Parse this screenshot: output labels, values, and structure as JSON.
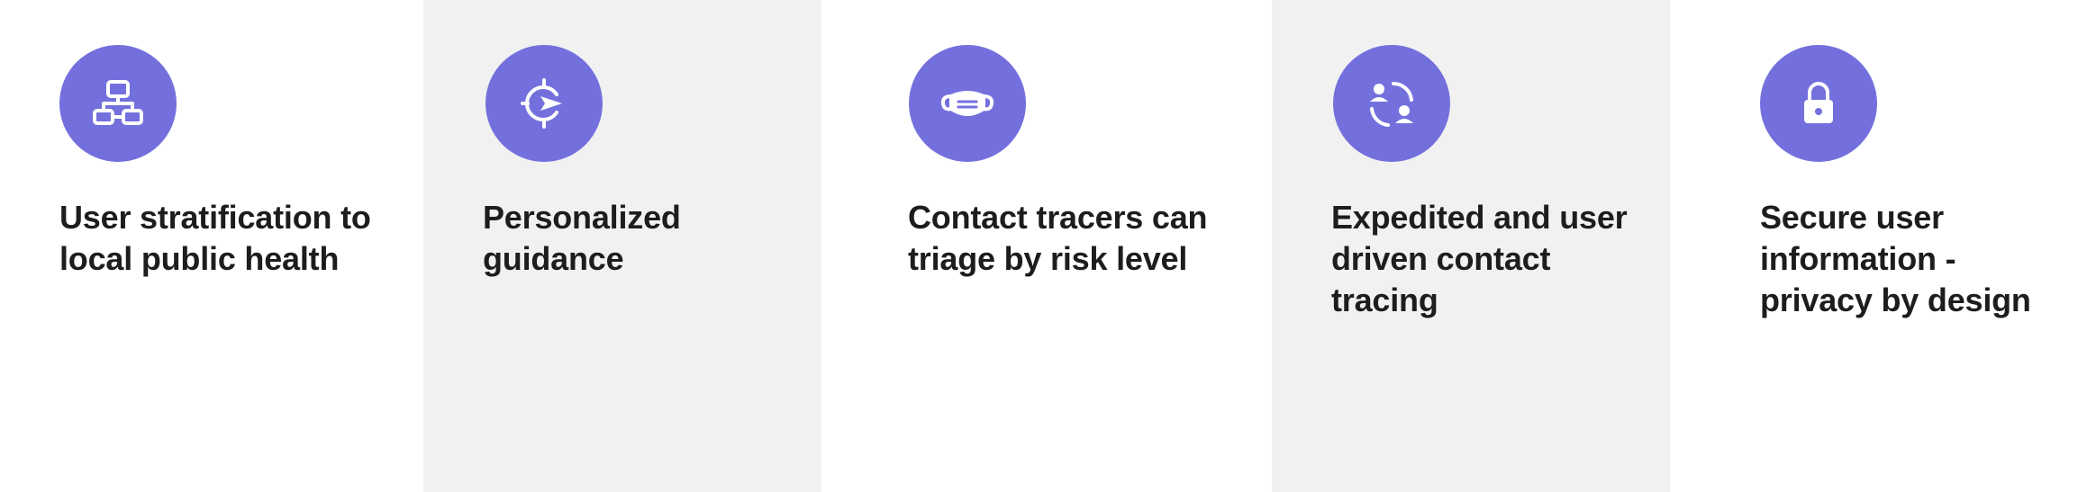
{
  "features": [
    {
      "id": "stratification",
      "icon": "hierarchy-icon",
      "title": "User stratification to local public health"
    },
    {
      "id": "guidance",
      "icon": "navigation-target-icon",
      "title": "Personalized guidance"
    },
    {
      "id": "triage",
      "icon": "face-mask-icon",
      "title": "Contact tracers can triage by risk level"
    },
    {
      "id": "tracing",
      "icon": "user-exchange-icon",
      "title": "Expedited and user driven contact tracing"
    },
    {
      "id": "privacy",
      "icon": "lock-icon",
      "title": "Secure user information - privacy by design"
    }
  ],
  "colors": {
    "accent": "#7370dd",
    "shaded_background": "#f1f1f2",
    "text": "#1d1d1f",
    "icon_foreground": "#ffffff"
  }
}
